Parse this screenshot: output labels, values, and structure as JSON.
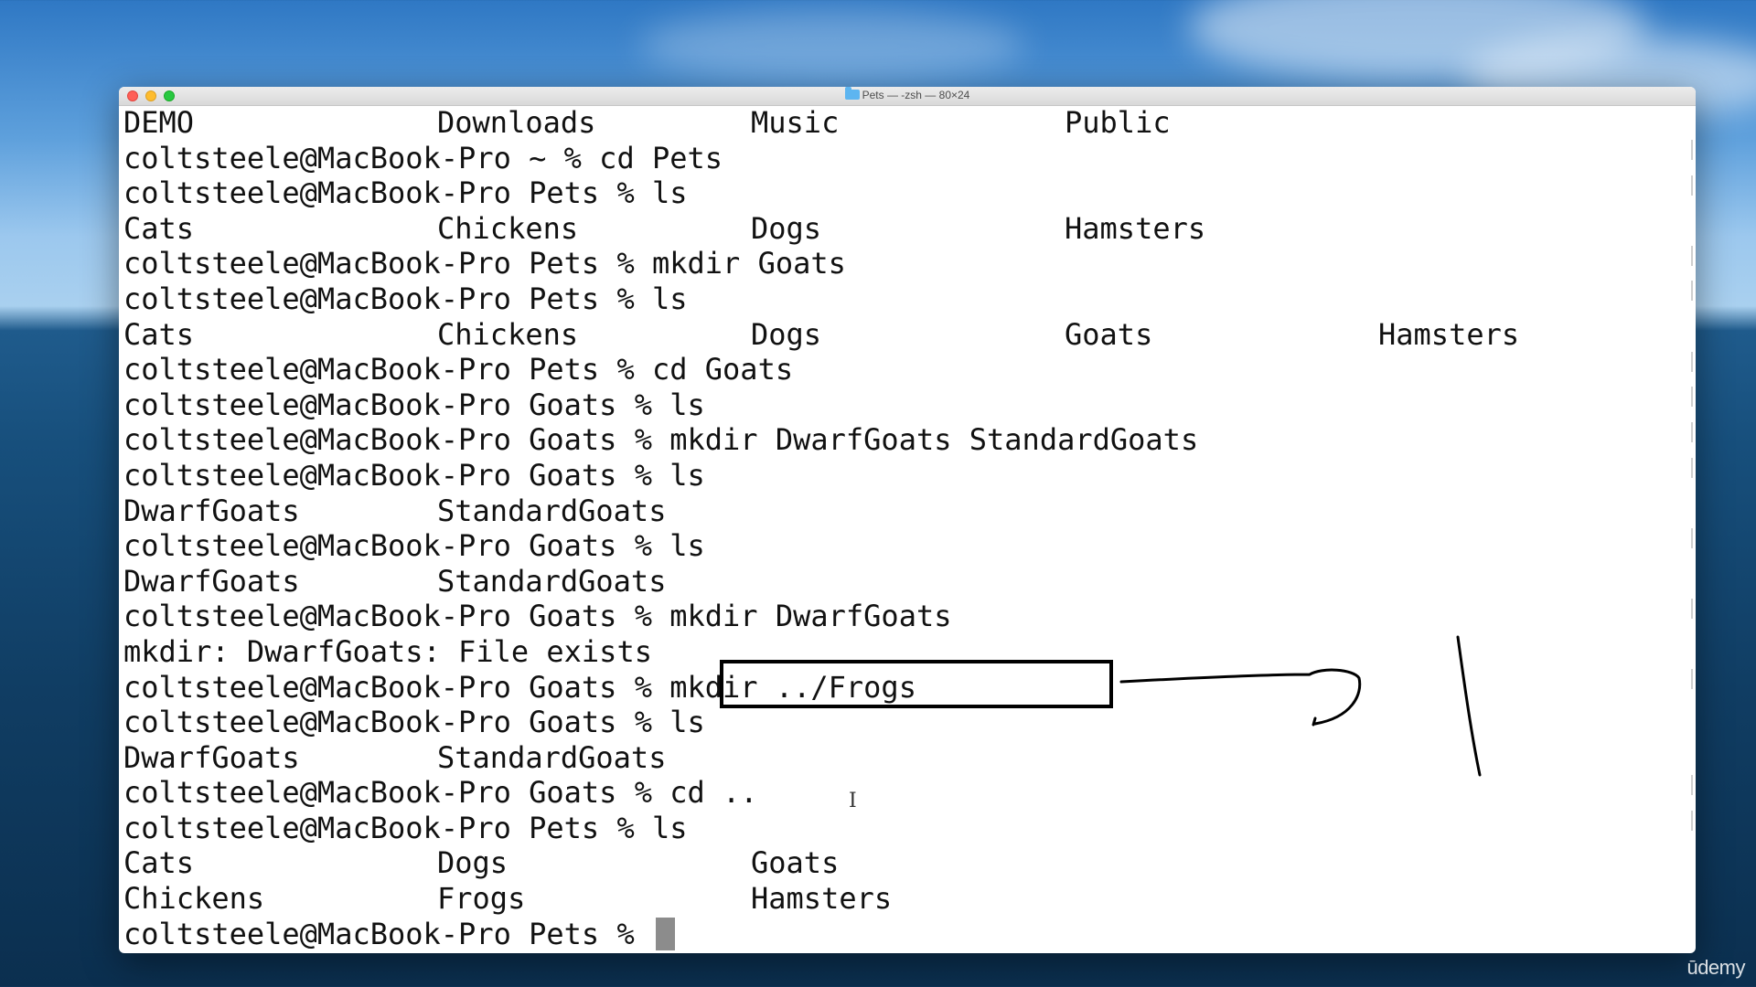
{
  "window": {
    "title": "Pets — -zsh — 80×24"
  },
  "terminal": {
    "lines": [
      {
        "cells": [
          "DEMO",
          "Downloads",
          "Music",
          "Public"
        ]
      },
      {
        "text": "coltsteele@MacBook-Pro ~ % cd Pets"
      },
      {
        "text": "coltsteele@MacBook-Pro Pets % ls"
      },
      {
        "cells": [
          "Cats",
          "Chickens",
          "Dogs",
          "Hamsters"
        ]
      },
      {
        "text": "coltsteele@MacBook-Pro Pets % mkdir Goats"
      },
      {
        "text": "coltsteele@MacBook-Pro Pets % ls"
      },
      {
        "cells": [
          "Cats",
          "Chickens",
          "Dogs",
          "Goats",
          "Hamsters"
        ]
      },
      {
        "text": "coltsteele@MacBook-Pro Pets % cd Goats"
      },
      {
        "text": "coltsteele@MacBook-Pro Goats % ls"
      },
      {
        "text": "coltsteele@MacBook-Pro Goats % mkdir DwarfGoats StandardGoats"
      },
      {
        "text": "coltsteele@MacBook-Pro Goats % ls"
      },
      {
        "cells": [
          "DwarfGoats",
          "StandardGoats"
        ]
      },
      {
        "text": "coltsteele@MacBook-Pro Goats % ls"
      },
      {
        "cells": [
          "DwarfGoats",
          "StandardGoats"
        ]
      },
      {
        "text": "coltsteele@MacBook-Pro Goats % mkdir DwarfGoats"
      },
      {
        "text": "mkdir: DwarfGoats: File exists"
      },
      {
        "text": "coltsteele@MacBook-Pro Goats % mkdir ../Frogs"
      },
      {
        "text": "coltsteele@MacBook-Pro Goats % ls"
      },
      {
        "cells": [
          "DwarfGoats",
          "StandardGoats"
        ]
      },
      {
        "text": "coltsteele@MacBook-Pro Goats % cd .."
      },
      {
        "text": "coltsteele@MacBook-Pro Pets % ls"
      },
      {
        "cells": [
          "Cats",
          "Dogs",
          "Goats"
        ]
      },
      {
        "cells": [
          "Chickens",
          "Frogs",
          "Hamsters"
        ]
      }
    ],
    "prompt": "coltsteele@MacBook-Pro Pets % "
  },
  "watermark": "ūdemy"
}
